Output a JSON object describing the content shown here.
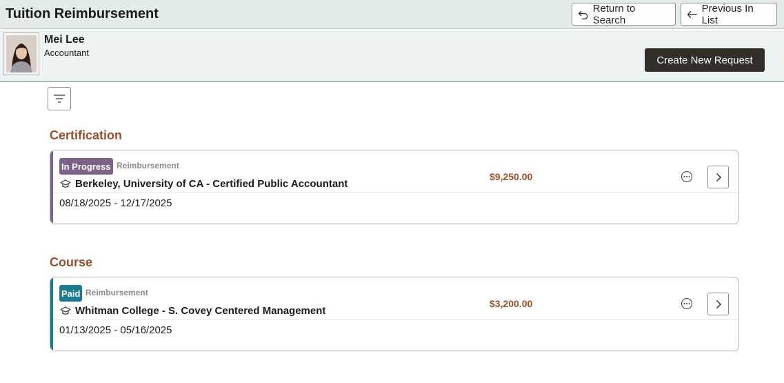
{
  "header": {
    "title": "Tuition Reimbursement",
    "return_label": "Return to Search",
    "previous_label": "Previous In List"
  },
  "employee": {
    "name": "Mei Lee",
    "role": "Accountant",
    "create_label": "Create New Request"
  },
  "icons": {
    "return": "return-arrow-icon",
    "previous": "left-arrow-icon",
    "filter": "filter-icon",
    "school": "graduation-cap-icon",
    "more": "more-options-icon",
    "open": "chevron-right-icon"
  },
  "colors": {
    "section_title": "#9a4f2c",
    "amount": "#9a4f2c",
    "in_progress": "#7c6189",
    "paid": "#1a7a8f",
    "create_button": "#332e2a"
  },
  "sections": [
    {
      "title": "Certification",
      "card": {
        "status": "In Progress",
        "type": "Reimbursement",
        "school": "Berkeley, University of CA - Certified Public Accountant",
        "dates": "08/18/2025 - 12/17/2025",
        "amount": "$9,250.00"
      }
    },
    {
      "title": "Course",
      "card": {
        "status": "Paid",
        "type": "Reimbursement",
        "school": "Whitman College - S. Covey Centered Management",
        "dates": "01/13/2025 - 05/16/2025",
        "amount": "$3,200.00"
      }
    }
  ]
}
